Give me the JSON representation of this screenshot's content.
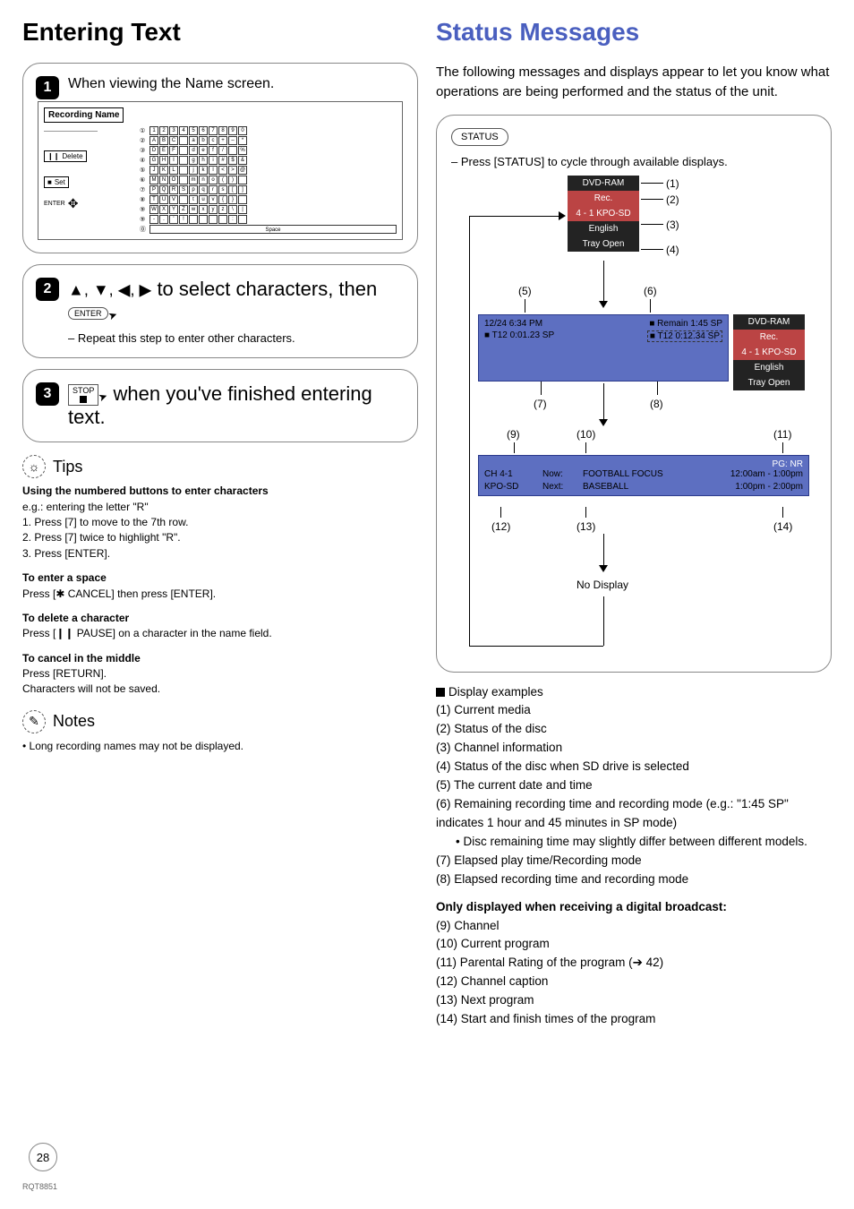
{
  "left": {
    "heading": "Entering Text",
    "step1": {
      "num": "1",
      "text": "When viewing the Name screen.",
      "screen_title": "Recording Name",
      "delete_label": "Delete",
      "set_label": "Set",
      "enter_label": "ENTER",
      "rows": [
        {
          "n": "①",
          "l": [
            "1",
            "2",
            "3",
            "4",
            "5",
            "6",
            "7",
            "8",
            "9",
            "0"
          ]
        },
        {
          "n": "②",
          "l": [
            "A",
            "B",
            "C",
            "",
            "a",
            "b",
            "c",
            "+",
            "–",
            "*"
          ]
        },
        {
          "n": "③",
          "l": [
            "D",
            "E",
            "F",
            "",
            "d",
            "e",
            "f",
            "/",
            "",
            "%"
          ]
        },
        {
          "n": "④",
          "l": [
            "G",
            "H",
            "I",
            "",
            "g",
            "h",
            "i",
            "#",
            "$",
            "&"
          ]
        },
        {
          "n": "⑤",
          "l": [
            "J",
            "K",
            "L",
            "",
            "j",
            "k",
            "l",
            "<",
            ">",
            "@"
          ]
        },
        {
          "n": "⑥",
          "l": [
            "M",
            "N",
            "O",
            "",
            "m",
            "n",
            "o",
            "(",
            ")",
            ""
          ]
        },
        {
          "n": "⑦",
          "l": [
            "P",
            "Q",
            "R",
            "S",
            "p",
            "q",
            "r",
            "s",
            "[",
            "]"
          ]
        },
        {
          "n": "⑧",
          "l": [
            "T",
            "U",
            "V",
            "",
            "t",
            "u",
            "v",
            "{",
            "}",
            ""
          ]
        },
        {
          "n": "⑨",
          "l": [
            "W",
            "X",
            "Y",
            "Z",
            "w",
            "x",
            "y",
            "z",
            "\\",
            "|"
          ]
        },
        {
          "n": "⑨",
          "l": [
            "-",
            ".",
            "'",
            "!",
            "",
            "",
            "",
            "",
            ":",
            ""
          ]
        },
        {
          "n": "⓪",
          "space": "Space"
        }
      ]
    },
    "step2": {
      "num": "2",
      "arrows": "▲, ▼, ◀, ▶",
      "text_mid": " to select characters, then ",
      "enter": "ENTER",
      "sub": "– Repeat this step to enter other characters."
    },
    "step3": {
      "num": "3",
      "stop_label": "STOP",
      "text": " when you've finished entering text."
    },
    "tips": {
      "title": "Tips",
      "h1": "Using the numbered buttons to enter characters",
      "l0": "e.g.: entering the letter \"R\"",
      "l1": "1. Press [7] to move to the 7th row.",
      "l2": "2. Press [7] twice to highlight \"R\".",
      "l3": "3. Press [ENTER].",
      "h2": "To enter a space",
      "l4": "Press [✱ CANCEL] then press [ENTER].",
      "h3": "To delete a character",
      "l5": "Press [❙❙ PAUSE] on a character in the name field.",
      "h4": "To cancel in the middle",
      "l6": "Press [RETURN].",
      "l7": "Characters will not be saved."
    },
    "notes": {
      "title": "Notes",
      "l1": "• Long recording names may not be displayed."
    }
  },
  "right": {
    "heading": "Status Messages",
    "intro": "The following messages and displays appear to let you know what operations are being performed and the status of the unit.",
    "status_pill": "STATUS",
    "press_line": "– Press [STATUS] to cycle through available displays.",
    "stack1": {
      "r1": "DVD-RAM",
      "r2": "Rec.",
      "r3": "4 - 1 KPO-SD",
      "r4": "English",
      "r5": "Tray Open",
      "c1": "(1)",
      "c2": "(2)",
      "c3": "(3)",
      "c4": "(4)"
    },
    "stack_side": {
      "r1": "DVD-RAM",
      "r2": "Rec.",
      "r3": "4 - 1 KPO-SD",
      "r4": "English",
      "r5": "Tray Open"
    },
    "panel2": {
      "date": "12/24 6:34 PM",
      "remain": "■ Remain   1:45  SP",
      "elapsed_play": "■ T12  0:01.23  SP",
      "elapsed_rec": "■ T12   0:12.34  SP",
      "c5": "(5)",
      "c6": "(6)",
      "c7": "(7)",
      "c8": "(8)"
    },
    "panel3": {
      "c9": "(9)",
      "c10": "(10)",
      "c11": "(11)",
      "c12": "(12)",
      "c13": "(13)",
      "c14": "(14)",
      "pg": "PG: NR",
      "ch": "CH 4-1",
      "now_l": "Now:",
      "now": "FOOTBALL FOCUS",
      "now_t": "12:00am - 1:00pm",
      "cap": "KPO-SD",
      "next_l": "Next:",
      "next": "BASEBALL",
      "next_t": "1:00pm - 2:00pm"
    },
    "no_display": "No Display",
    "display_examples": "Display examples",
    "list": [
      "(1) Current media",
      "(2) Status of the disc",
      "(3) Channel information",
      "(4) Status of the disc when SD drive is selected",
      "(5) The current date and time",
      "(6) Remaining recording time and recording mode (e.g.: \"1:45 SP\" indicates 1 hour and 45 minutes in SP mode)",
      "   •  Disc remaining time may slightly differ between different models.",
      "(7) Elapsed play time/Recording mode",
      "(8) Elapsed recording time and recording mode"
    ],
    "digital_hdr": "Only displayed when receiving a digital broadcast:",
    "list2": [
      "(9) Channel",
      "(10) Current program",
      "(11) Parental Rating of the program (➔ 42)",
      "(12) Channel caption",
      "(13) Next program",
      "(14) Start and finish times of the program"
    ]
  },
  "page_number": "28",
  "doc_id": "RQT8851"
}
